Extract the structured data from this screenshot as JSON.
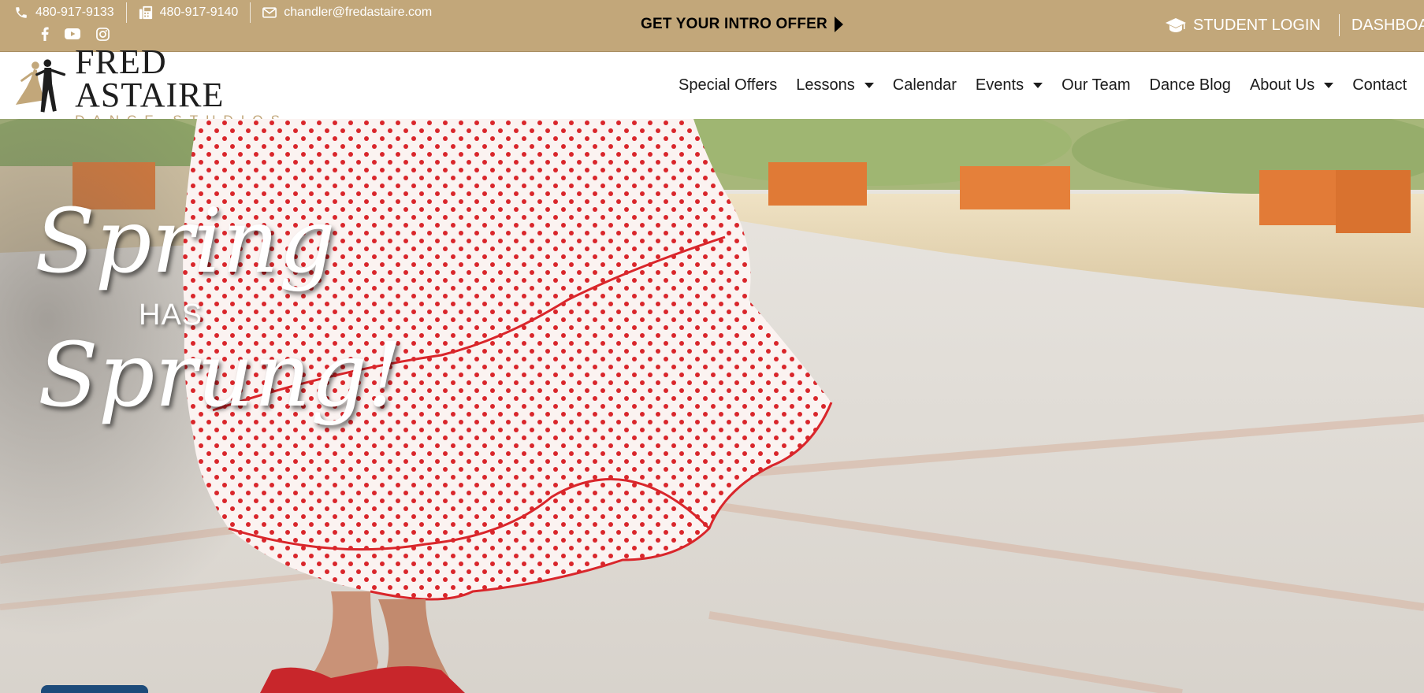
{
  "topbar": {
    "phone": "480-917-9133",
    "fax": "480-917-9140",
    "email": "chandler@fredastaire.com",
    "social": [
      "facebook-icon",
      "youtube-icon",
      "instagram-icon"
    ],
    "intro_offer": "GET YOUR INTRO OFFER",
    "student_login": "STUDENT LOGIN",
    "dashboard": "DASHBOARD"
  },
  "logo": {
    "main": "FRED ASTAIRE",
    "sub": "DANCE STUDIOS"
  },
  "nav": {
    "items": [
      {
        "label": "Special Offers"
      },
      {
        "label": "Lessons"
      },
      {
        "label": "Calendar"
      },
      {
        "label": "Events"
      },
      {
        "label": "Our Team"
      },
      {
        "label": "Dance Blog"
      },
      {
        "label": "About Us"
      },
      {
        "label": "Contact"
      }
    ]
  },
  "hero": {
    "line1": "Spring",
    "line2": "HAS",
    "line3": "Sprung!"
  },
  "colors": {
    "topbar": "#c2a77a",
    "text_dark": "#1b1b1b",
    "dress_red": "#d9262b",
    "button_blue": "#1d4b7a"
  }
}
